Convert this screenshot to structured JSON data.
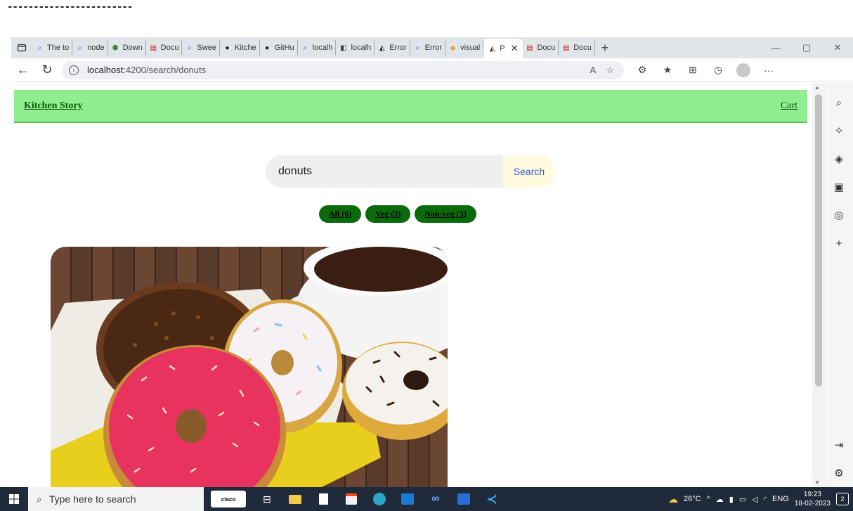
{
  "top_text": "------------------------",
  "browser": {
    "tabs": [
      {
        "label": "The to",
        "icon": "search-icon"
      },
      {
        "label": "node",
        "icon": "search-icon"
      },
      {
        "label": "Down",
        "icon": "nodejs-icon"
      },
      {
        "label": "Docu",
        "icon": "pdf-icon"
      },
      {
        "label": "Swee",
        "icon": "search-icon"
      },
      {
        "label": "Kitche",
        "icon": "github-icon"
      },
      {
        "label": "GitHu",
        "icon": "github-icon"
      },
      {
        "label": "localh",
        "icon": "search-icon"
      },
      {
        "label": "localh",
        "icon": "page-icon"
      },
      {
        "label": "Error",
        "icon": "angular-icon"
      },
      {
        "label": "Error",
        "icon": "search-icon"
      },
      {
        "label": "visual",
        "icon": "bookmark-icon"
      },
      {
        "label": "Docu",
        "icon": "pdf-icon"
      },
      {
        "label": "Docu",
        "icon": "pdf-icon"
      }
    ],
    "active_tab": {
      "label": "P",
      "icon": "angular-icon"
    },
    "url_host": "localhost",
    "url_path": ":4200/search/donuts"
  },
  "site": {
    "brand": "Kitchen Story",
    "cart": "Cart",
    "search_value": "donuts",
    "search_button": "Search",
    "filters": [
      "All (6)",
      "Veg (3)",
      "Non-veg (3)"
    ]
  },
  "taskbar": {
    "search_placeholder": "Type here to search",
    "cisco": "cisco",
    "weather": "26°C",
    "lang": "ENG",
    "time": "19:23",
    "date": "18-02-2023",
    "notifications": "2"
  },
  "colors": {
    "header_bg": "#90ee90",
    "chip_bg": "#0b6b0b",
    "search_btn_bg": "#fffbdf",
    "search_btn_text": "#3a57c9"
  }
}
